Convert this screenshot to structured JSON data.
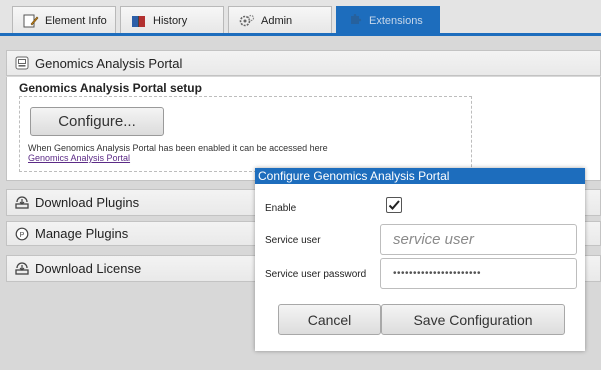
{
  "tabs": [
    {
      "label": "Element Info",
      "icon": "document-edit-icon"
    },
    {
      "label": "History",
      "icon": "book-icon"
    },
    {
      "label": "Admin",
      "icon": "gears-icon"
    },
    {
      "label": "Extensions",
      "icon": "puzzle-icon"
    }
  ],
  "active_tab": "Extensions",
  "sections": {
    "portal": "Genomics Analysis Portal",
    "download_plugins": "Download Plugins",
    "manage_plugins": "Manage Plugins",
    "download_license": "Download License"
  },
  "setup": {
    "title": "Genomics Analysis Portal setup",
    "configure_label": "Configure...",
    "note": "When Genomics Analysis Portal has been enabled it can be accessed here",
    "link": "Genomics Analysis Portal"
  },
  "dialog": {
    "title": "Configure Genomics Analysis Portal",
    "enable_label": "Enable",
    "enable_checked": true,
    "user_label": "Service user",
    "user_placeholder": "service user",
    "password_label": "Service user password",
    "password_value": "••••••••••••••••••••••",
    "cancel_label": "Cancel",
    "save_label": "Save Configuration"
  },
  "colors": {
    "accent": "#1d6dbd",
    "link": "#5b2a86"
  }
}
